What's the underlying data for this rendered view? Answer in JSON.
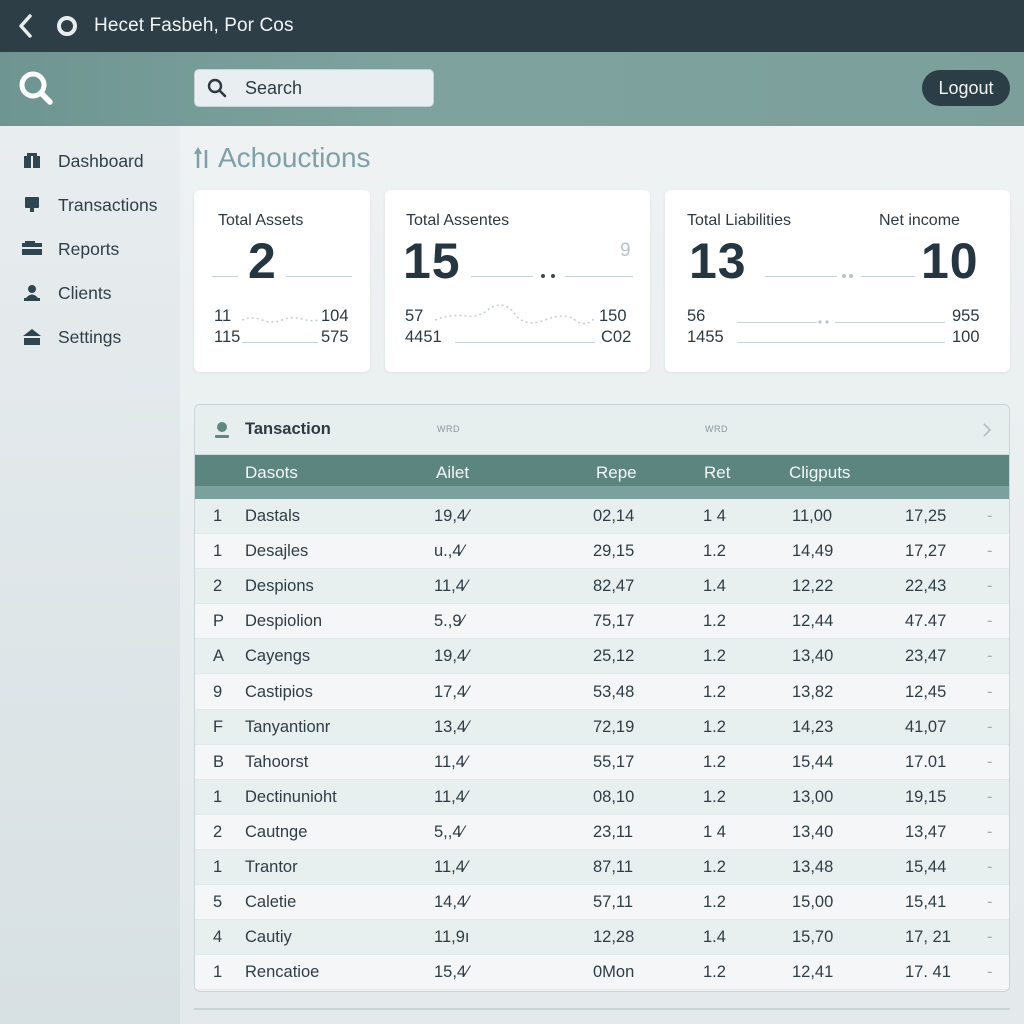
{
  "titlebar": {
    "title": "Hecet Fasbeh, Por Cos"
  },
  "header": {
    "search_placeholder": "Search",
    "logout_label": "Logout"
  },
  "sidebar": {
    "items": [
      {
        "label": "Dashboard",
        "icon": "dashboard-icon"
      },
      {
        "label": "Transactions",
        "icon": "transactions-icon"
      },
      {
        "label": "Reports",
        "icon": "reports-icon"
      },
      {
        "label": "Clients",
        "icon": "clients-icon"
      },
      {
        "label": "Settings",
        "icon": "settings-icon"
      }
    ]
  },
  "main": {
    "title": "Achouctions",
    "cards": [
      {
        "label": "Total Assets",
        "value": "2",
        "stats": [
          "11",
          "104",
          "115",
          "575"
        ]
      },
      {
        "label": "Total Assentes",
        "value": "15",
        "hint": "9",
        "stats": [
          "57",
          "150",
          "4451",
          "C02"
        ]
      },
      {
        "label": "Total Liabilities",
        "value": "13",
        "label2": "Net income",
        "value2": "10",
        "stats": [
          "56",
          "955",
          "1455",
          "100"
        ]
      }
    ],
    "table": {
      "title": "Tansaction",
      "hint1": "WRD",
      "hint2": "WRD",
      "columns": [
        "Dasots",
        "Ailet",
        "Repe",
        "Ret",
        "Cligputs"
      ],
      "rows": [
        [
          "1",
          "Dastals",
          "19,4⁄",
          "02,14",
          "1 4",
          "11,00",
          "17,25",
          "-"
        ],
        [
          "1",
          "Desajles",
          "u.,4⁄",
          "29,15",
          "1.2",
          "14,49",
          "17,27",
          "-"
        ],
        [
          "2",
          "Despions",
          "11,4⁄",
          "82,47",
          "1.4",
          "12,22",
          "22,43",
          "-"
        ],
        [
          "P",
          "Despiolion",
          "5.,9⁄",
          "75,17",
          "1.2",
          "12,44",
          "47.47",
          "-"
        ],
        [
          "A",
          "Cayengs",
          "19,4⁄",
          "25,12",
          "1.2",
          "13,40",
          "23,47",
          "-"
        ],
        [
          "9",
          "Castipios",
          "17,4⁄",
          "53,48",
          "1.2",
          "13,82",
          "12,45",
          "-"
        ],
        [
          "F",
          "Tanyantionr",
          "13,4⁄",
          "72,19",
          "1.2",
          "14,23",
          "41,07",
          "-"
        ],
        [
          "B",
          "Tahoorst",
          "11,4⁄",
          "55,17",
          "1.2",
          "15,44",
          "17.01",
          "-"
        ],
        [
          "1",
          "Dectinunioht",
          "11,4⁄",
          "08,10",
          "1.2",
          "13,00",
          "19,15",
          "-"
        ],
        [
          "2",
          "Cautnge",
          "5,,4⁄",
          "23,11",
          "1 4",
          "13,40",
          "13,47",
          "-"
        ],
        [
          "1",
          "Trantor",
          "11,4⁄",
          "87,11",
          "1.2",
          "13,48",
          "15,44",
          "-"
        ],
        [
          "5",
          "Caletie",
          "14,4⁄",
          "57,11",
          "1.2",
          "15,00",
          "15,41",
          "-"
        ],
        [
          "4",
          "Cautiy",
          "11,9ı",
          "12,28",
          "1.4",
          "15,70",
          "17, 21",
          "-"
        ],
        [
          "1",
          "Rencatioe",
          "15,4⁄",
          "0Mon",
          "1.2",
          "12,41",
          "17. 41",
          "-"
        ]
      ]
    }
  }
}
